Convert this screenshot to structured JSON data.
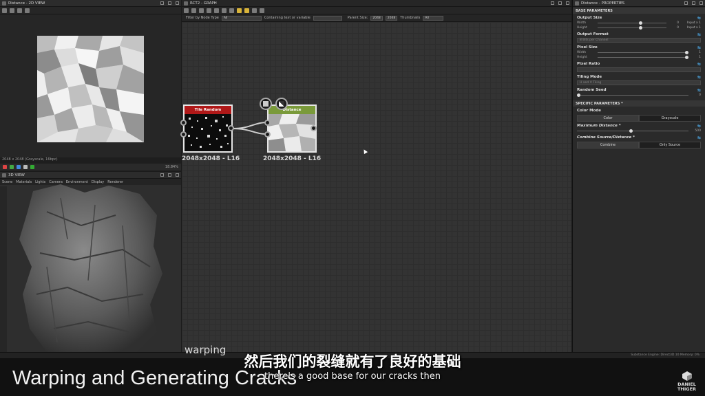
{
  "view2d": {
    "title": "Distance - 2D VIEW",
    "status": "2048 x 2048 (Grayscale, 16bpc)",
    "zoom": "18.84%"
  },
  "view3d": {
    "title": "3D VIEW",
    "menu": [
      "Scene",
      "Materials",
      "Lights",
      "Camera",
      "Environment",
      "Display",
      "Renderer"
    ]
  },
  "graph": {
    "title": "RCT2 - GRAPH",
    "filter_label": "Filter by Node Type",
    "filter_value": "All",
    "contains_label": "Containing text or variable",
    "parent_size_label": "Parent Size:",
    "parent_size_w": "2048",
    "parent_size_h": "2048",
    "thumbnails_label": "Thumbnails",
    "thumbnails_value": "All",
    "nodes": [
      {
        "title": "Tile Random",
        "label": "2048x2048 - L16",
        "color": "#b01818"
      },
      {
        "title": "Distance",
        "label": "2048x2048 - L16",
        "color": "#7a9a3a"
      }
    ],
    "watermark_text": "warping"
  },
  "properties": {
    "title": "Distance - PROPERTIES",
    "base_header": "BASE PARAMETERS",
    "output_size": {
      "title": "Output Size",
      "width_label": "Width",
      "width_val": "0",
      "width_extra": "Input x 1",
      "height_label": "Height",
      "height_val": "0",
      "height_extra": "Input x 1"
    },
    "output_format": {
      "title": "Output Format",
      "value": "8 Bits per Channel"
    },
    "pixel_size": {
      "title": "Pixel Size",
      "width_label": "Width",
      "width_val": "1",
      "height_label": "Height",
      "height_val": "1"
    },
    "pixel_ratio": {
      "title": "Pixel Ratio"
    },
    "tiling_mode": {
      "title": "Tiling Mode",
      "value": "H and V Tiling"
    },
    "random_seed": {
      "title": "Random Seed",
      "value": "0"
    },
    "specific_header": "SPECIFIC PARAMETERS *",
    "color_mode": {
      "title": "Color Mode",
      "opt1": "Color",
      "opt2": "Grayscale"
    },
    "max_distance": {
      "title": "Maximum Distance *",
      "value": "500"
    },
    "combine": {
      "title": "Combine Source/Distance *",
      "opt1": "Combine",
      "opt2": "Only Source"
    }
  },
  "statusbar": {
    "engine": "Substance Engine: Direct3D 10   Memory: 0%"
  },
  "overlay": {
    "lecture_title": "Warping and Generating Cracks",
    "subtitle_zh": "然后我们的裂缝就有了良好的基础",
    "subtitle_en": "there's a good base for our cracks then",
    "brand_line1": "DANIEL",
    "brand_line2": "THIGER"
  }
}
